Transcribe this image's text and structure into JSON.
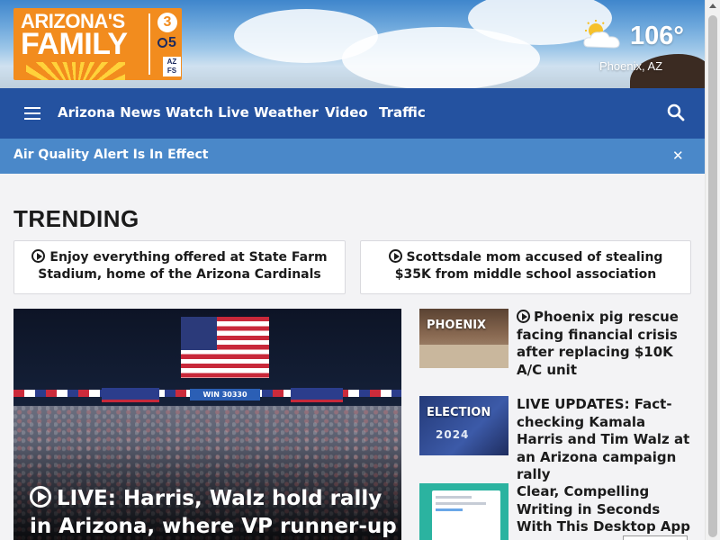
{
  "brand": {
    "logo_line1": "ARIZONA'S",
    "logo_line2": "FAMILY",
    "badge_channel": "3",
    "badge_network": "5",
    "badge_azfs": "AZ FS",
    "colors": {
      "orange": "#f28c1e",
      "nav_blue": "#2452a0",
      "alert_blue": "#4a88c9"
    }
  },
  "weather": {
    "icon": "partly-cloudy-icon",
    "temperature": "106°",
    "location": "Phoenix, AZ"
  },
  "nav": {
    "menu_icon": "hamburger-menu-icon",
    "items": [
      "Arizona News",
      "Watch Live",
      "Weather",
      "Video",
      "Traffic"
    ],
    "search_icon": "search-icon"
  },
  "alert": {
    "text": "Air Quality Alert Is In Effect",
    "close": "✕"
  },
  "trending": {
    "heading": "TRENDING",
    "items": [
      "Enjoy everything offered at State Farm Stadium, home of the Arizona Cardinals",
      "Scottsdale mom accused of stealing $35K from middle school association"
    ]
  },
  "hero": {
    "headline": "LIVE: Harris, Walz hold rally in Arizona, where VP runner-up",
    "sign_text": "WIN 30330"
  },
  "stories": [
    {
      "label": "PHOENIX",
      "title": "Phoenix pig rescue facing financial crisis after replacing $10K A/C unit",
      "video": true
    },
    {
      "label": "ELECTION",
      "title": "LIVE UPDATES: Fact-checking Kamala Harris and Tim Walz at an Arizona campaign rally",
      "video": false,
      "thumb_text": "2024"
    },
    {
      "label": "",
      "title": "Clear, Compelling Writing in Seconds With This Desktop App",
      "video": false,
      "sponsored": true
    }
  ]
}
